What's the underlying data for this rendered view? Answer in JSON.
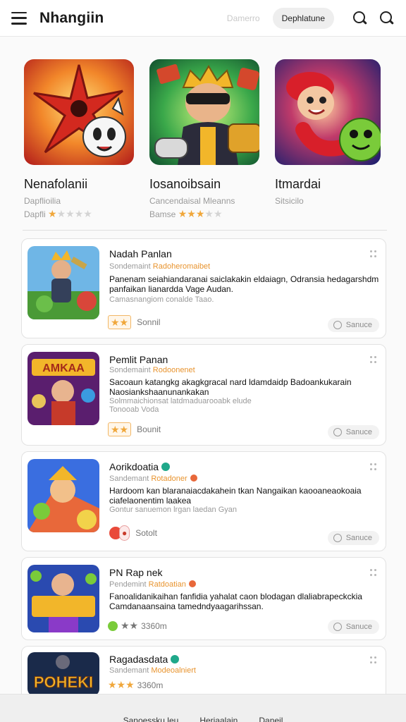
{
  "header": {
    "title": "Nhangiin",
    "ghost_tab": "Damerro",
    "active_tab": "Dephlatune"
  },
  "featured": [
    {
      "title": "Nenafolanii",
      "subtitle": "Dapflioilia",
      "stars_label": "Dapfli",
      "rating": 1,
      "rating_max": 5
    },
    {
      "title": "Iosanoibsain",
      "subtitle": "Cancendaisal Mleanns",
      "stars_label": "Bamse",
      "rating": 3,
      "rating_max": 5
    },
    {
      "title": "Itmardai",
      "subtitle": "Sitsicilo",
      "stars_label": "",
      "rating": 0,
      "rating_max": 5
    }
  ],
  "list": [
    {
      "title": "Nadah Panlan",
      "meta_prefix": "Sondemaint",
      "meta_highlight": "Radoheromaibet",
      "desc": "Panenam seiahiandaranai saiclakakin eldaiagn, Odransia hedagarshdm panfaikan lianardda Vage Audan.",
      "note": "Camasnangiom conalde Taao.",
      "rating_text": "Sonnil",
      "action": "Sanuce"
    },
    {
      "title": "Pemlit Panan",
      "meta_prefix": "Sondemaint",
      "meta_highlight": "Rodoonenet",
      "desc": "Sacoaun katangkg akagkgracal nard ldamdaidp Badoankukarain Naosiankshaanunankakan",
      "note": "Solmmaichionsat latdmaduarooabk elude",
      "note2": "Tonooab Voda",
      "rating_text": "Bounit",
      "action": "Sanuce"
    },
    {
      "title": "Aorikdoatia",
      "meta_prefix": "Sandemant",
      "meta_highlight": "Rotadoner",
      "desc": "Hardoom kan blaranaiacdakahein tkan Nangaikan kaooaneaokoaia ciafelaonentim laakea",
      "note": "Gontur sanuemon lrgan laedan Gyan",
      "rating_text": "Sotolt",
      "action": "Sanuce"
    },
    {
      "title": "PN Rap nek",
      "meta_prefix": "Pendemint",
      "meta_highlight": "Ratdoatian",
      "desc": "Fanoalidanikaihan fanfidia yahalat caon blodagan dlaliabrapeckckia Camdanaansaina tamedndyaagarihssan.",
      "note": "",
      "rating_text": "3360m",
      "action": "Sanuce"
    },
    {
      "title": "Ragadasdata",
      "meta_prefix": "Sandemant",
      "meta_highlight": "Modeoalniert",
      "desc": "",
      "note": "",
      "rating_text": "3360m",
      "action": ""
    }
  ],
  "bottom_bar": [
    "Sanoessku leu",
    "Heriaalain",
    "Daneil"
  ],
  "colors": {
    "accent": "#e8942f",
    "star": "#f0a73b"
  }
}
